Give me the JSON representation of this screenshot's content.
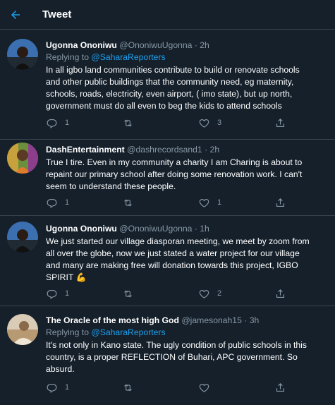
{
  "header": {
    "title": "Tweet"
  },
  "tweets": [
    {
      "name": "Ugonna Ononiwu",
      "handle": "@OnoniwuUgonna",
      "time": "2h",
      "replying_prefix": "Replying to ",
      "replying_to": "@SaharaReporters",
      "text": "In all igbo land communities contribute to build or renovate schools\nand other public buildings that the community need, eg maternity,\nschools, roads, electricity, even airport, ( imo state), but up north,\ngovernment must do all  even to beg the kids to attend schools",
      "replies": "1",
      "retweets": "",
      "likes": "3"
    },
    {
      "name": "DashEntertainment",
      "handle": "@dashrecordsand1",
      "time": "2h",
      "text": "True I tire. Even in my community a charity I am Charing is about to\nrepaint our primary school after doing some renovation work. I can't\nseem to understand these people.",
      "replies": "1",
      "retweets": "",
      "likes": "1"
    },
    {
      "name": "Ugonna Ononiwu",
      "handle": "@OnoniwuUgonna",
      "time": "1h",
      "text": "We just started our village diasporan meeting, we meet by zoom from\nall over the globe, now we just stated a water project for our village\nand many are making free will donation towards this project, IGBO\nSPIRIT",
      "emoji": "💪",
      "replies": "1",
      "retweets": "",
      "likes": "2"
    },
    {
      "name": "The Oracle of the most high God",
      "handle": "@jamesonah15",
      "time": "3h",
      "replying_prefix": "Replying to ",
      "replying_to": "@SaharaReporters",
      "text": "It's not only in Kano state. The ugly condition of public schools in this\ncountry, is a proper REFLECTION of  Buhari, APC government. So\nabsurd.",
      "replies": "1",
      "retweets": "",
      "likes": ""
    }
  ],
  "colors": {
    "background": "#15202b",
    "accent": "#1da1f2",
    "muted": "#8899a6",
    "divider": "#38444d"
  },
  "icons": [
    "back-arrow-icon",
    "reply-icon",
    "retweet-icon",
    "like-icon",
    "share-icon"
  ]
}
